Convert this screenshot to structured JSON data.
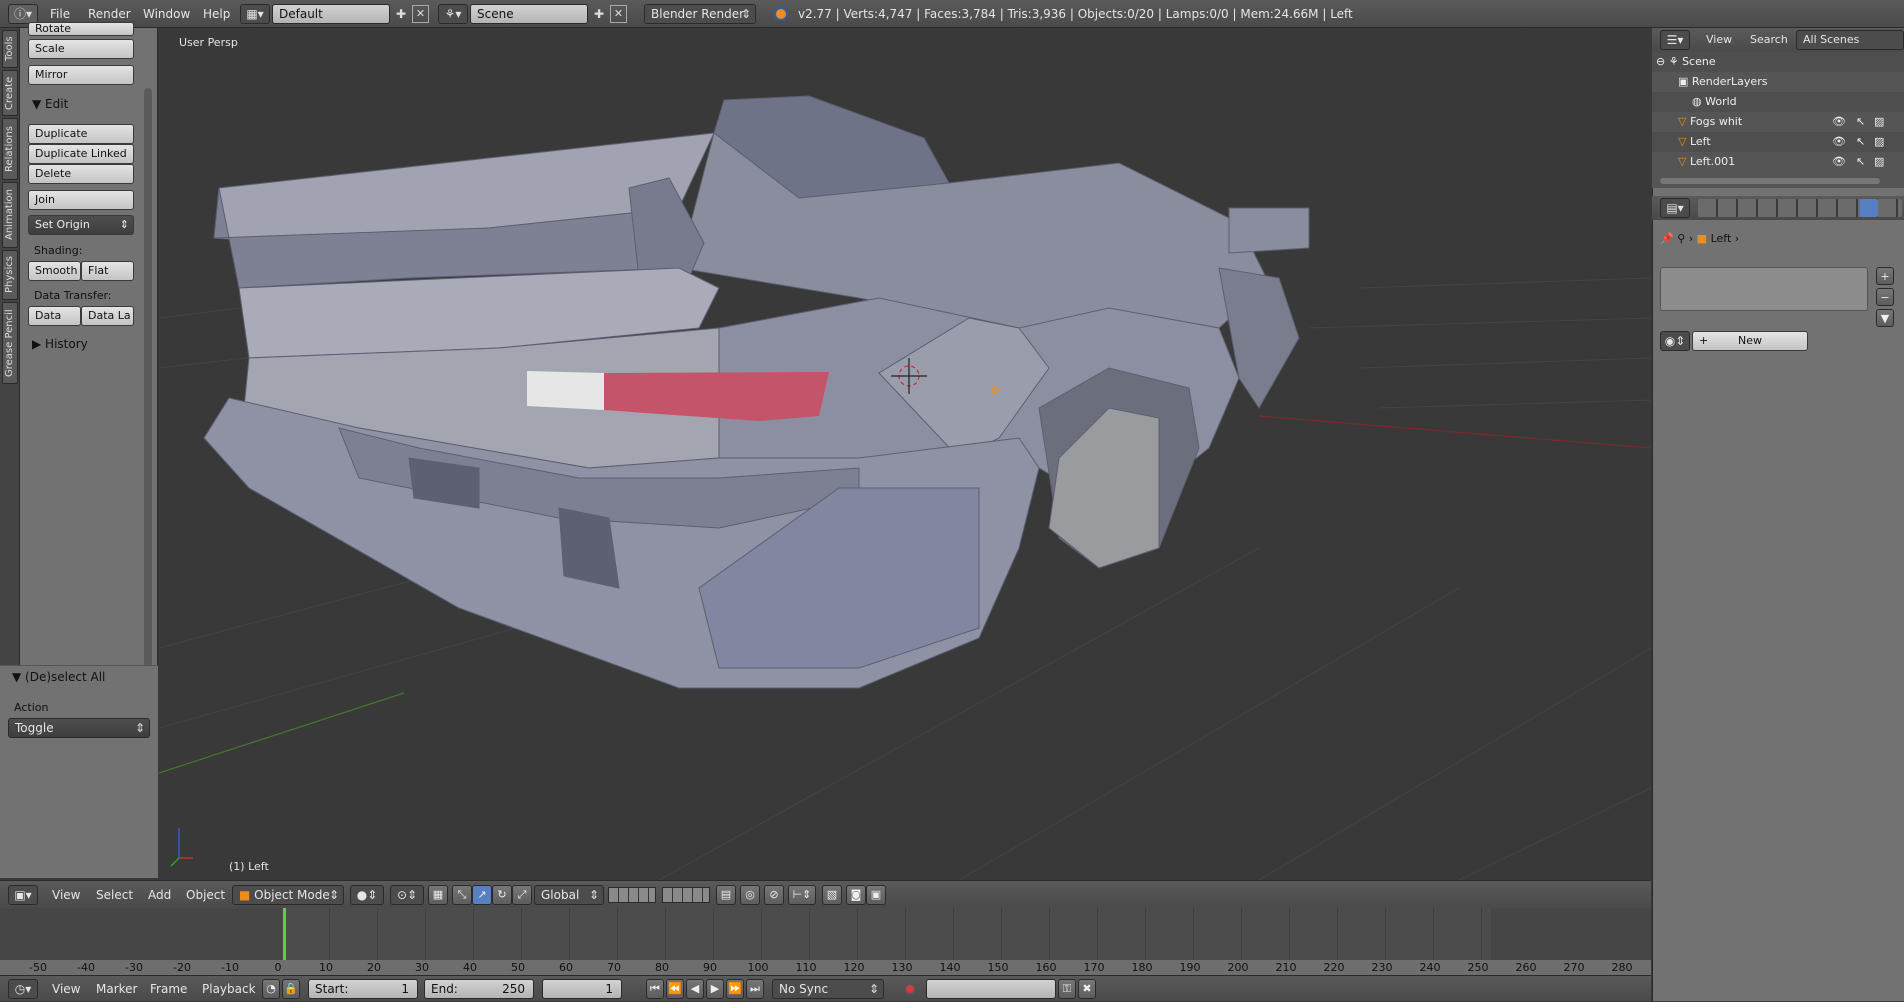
{
  "topbar": {
    "menus": [
      "File",
      "Render",
      "Window",
      "Help"
    ],
    "layout": "Default",
    "scene": "Scene",
    "engine": "Blender Render",
    "stats": "v2.77 | Verts:4,747 | Faces:3,784 | Tris:3,936 | Objects:0/20 | Lamps:0/0 | Mem:24.66M | Left"
  },
  "lefttabs": [
    "Tools",
    "Create",
    "Relations",
    "Animation",
    "Physics",
    "Grease Pencil"
  ],
  "toolshelf": {
    "rotate": "Rotate",
    "scale": "Scale",
    "mirror": "Mirror",
    "edit_header": "Edit",
    "duplicate": "Duplicate",
    "duplicate_linked": "Duplicate Linked",
    "delete": "Delete",
    "join": "Join",
    "set_origin": "Set Origin",
    "shading_label": "Shading:",
    "smooth": "Smooth",
    "flat": "Flat",
    "data_transfer_label": "Data Transfer:",
    "data": "Data",
    "data_la": "Data La",
    "history": "History",
    "deselect_header": "(De)select All",
    "action_label": "Action",
    "action_value": "Toggle"
  },
  "viewport": {
    "persp": "User Persp",
    "object_label": "(1) Left"
  },
  "bottom_header": {
    "menus": [
      "View",
      "Select",
      "Add",
      "Object"
    ],
    "mode": "Object Mode",
    "orientation": "Global"
  },
  "timeline": {
    "ticks": [
      "-50",
      "-40",
      "-30",
      "-20",
      "-10",
      "0",
      "10",
      "20",
      "30",
      "40",
      "50",
      "60",
      "70",
      "80",
      "90",
      "100",
      "110",
      "120",
      "130",
      "140",
      "150",
      "160",
      "170",
      "180",
      "190",
      "200",
      "210",
      "220",
      "230",
      "240",
      "250",
      "260",
      "270",
      "280"
    ]
  },
  "timebar": {
    "menus": [
      "View",
      "Marker",
      "Frame",
      "Playback"
    ],
    "start_label": "Start:",
    "start": "1",
    "end_label": "End:",
    "end": "250",
    "current": "1",
    "sync": "No Sync"
  },
  "outliner": {
    "menus": [
      "View",
      "Search"
    ],
    "scenes": "All Scenes",
    "rows": [
      "Scene",
      "RenderLayers",
      "World",
      "Fogs whit",
      "Left",
      "Left.001"
    ]
  },
  "properties": {
    "object": "Left",
    "new_button": "New"
  },
  "colors": {
    "accent": "#5680c2",
    "selection": "#f08c1e",
    "car_tail": "#c4546a"
  }
}
